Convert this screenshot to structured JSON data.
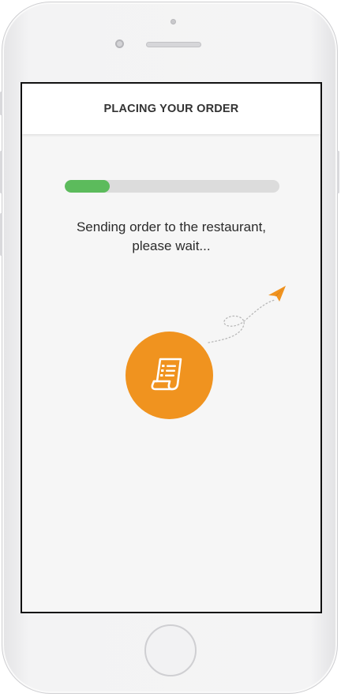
{
  "header": {
    "title": "PLACING YOUR ORDER"
  },
  "progress": {
    "percent": 21,
    "fill_color": "#5cbb5c",
    "track_color": "#dcdcdc"
  },
  "status": {
    "line1": "Sending order to the restaurant,",
    "line2": "please wait..."
  },
  "illustration": {
    "icon": "receipt-icon",
    "circle_color": "#f0931f",
    "plane_icon": "paper-plane-icon"
  }
}
